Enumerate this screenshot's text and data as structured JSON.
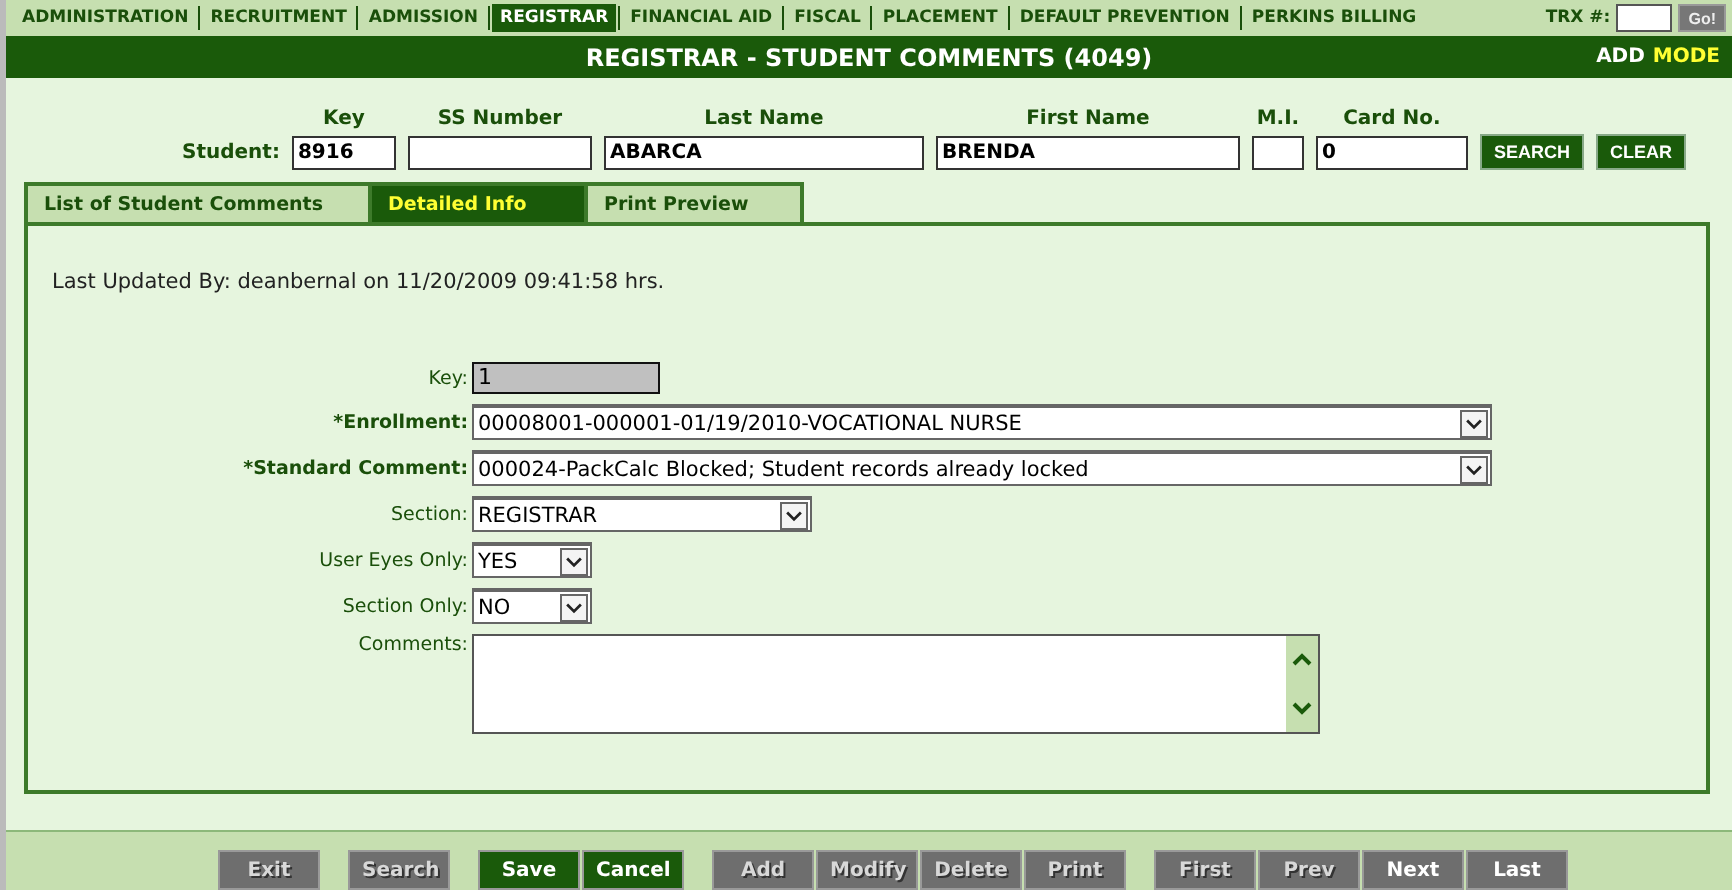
{
  "nav": [
    {
      "label": "ADMINISTRATION",
      "selected": false
    },
    {
      "label": "RECRUITMENT",
      "selected": false
    },
    {
      "label": "ADMISSION",
      "selected": false
    },
    {
      "label": "REGISTRAR",
      "selected": true
    },
    {
      "label": "FINANCIAL AID",
      "selected": false
    },
    {
      "label": "FISCAL",
      "selected": false
    },
    {
      "label": "PLACEMENT",
      "selected": false
    },
    {
      "label": "DEFAULT PREVENTION",
      "selected": false
    },
    {
      "label": "PERKINS BILLING",
      "selected": false
    }
  ],
  "trx": {
    "label": "TRX #:",
    "go": "Go!"
  },
  "title": "REGISTRAR - STUDENT COMMENTS (4049)",
  "mode": {
    "action": "ADD",
    "label": "MODE"
  },
  "student": {
    "label": "Student:",
    "fields": [
      {
        "heading": "Key",
        "value": "8916"
      },
      {
        "heading": "SS Number"
      },
      {
        "heading": "Last Name",
        "value": "ABARCA"
      },
      {
        "heading": "First Name",
        "value": "BRENDA"
      },
      {
        "heading": "M.I."
      },
      {
        "heading": "Card No.",
        "value": "0"
      }
    ],
    "buttons": [
      "SEARCH",
      "CLEAR"
    ]
  },
  "tabs": [
    {
      "label": "List of Student Comments",
      "selected": false
    },
    {
      "label": "Detailed Info",
      "selected": true
    },
    {
      "label": "Print Preview",
      "selected": false
    }
  ],
  "last_updated": "Last Updated By: deanbernal on 11/20/2009 09:41:58 hrs.",
  "form": [
    {
      "kind": "readonly",
      "label": "Key:",
      "required": false,
      "value": "1"
    },
    {
      "kind": "wide-select",
      "label": "*Enrollment:",
      "required": true,
      "value": "00008001-000001-01/19/2010-VOCATIONAL NURSE"
    },
    {
      "kind": "wide-select",
      "label": "*Standard Comment:",
      "required": true,
      "value": "000024-PackCalc Blocked; Student records already locked"
    },
    {
      "kind": "medium-select",
      "label": "Section:",
      "required": false,
      "value": "REGISTRAR"
    },
    {
      "kind": "small-select",
      "label": "User Eyes Only:",
      "required": false,
      "value": "YES"
    },
    {
      "kind": "small-select",
      "label": "Section Only:",
      "required": false,
      "value": "NO"
    },
    {
      "kind": "textarea",
      "label": "Comments:",
      "required": false
    }
  ],
  "actions": [
    [
      {
        "label": "Exit",
        "kind": "disabled"
      }
    ],
    [
      {
        "label": "Search",
        "kind": "disabled"
      }
    ],
    [
      {
        "label": "Save",
        "kind": "primary"
      },
      {
        "label": "Cancel",
        "kind": "primary"
      }
    ],
    [
      {
        "label": "Add",
        "kind": "disabled"
      },
      {
        "label": "Modify",
        "kind": "disabled"
      },
      {
        "label": "Delete",
        "kind": "disabled"
      },
      {
        "label": "Print",
        "kind": "disabled"
      }
    ],
    [
      {
        "label": "First",
        "kind": "disabled"
      },
      {
        "label": "Prev",
        "kind": "disabled"
      },
      {
        "label": "Next",
        "kind": "nav"
      },
      {
        "label": "Last",
        "kind": "nav"
      }
    ]
  ]
}
